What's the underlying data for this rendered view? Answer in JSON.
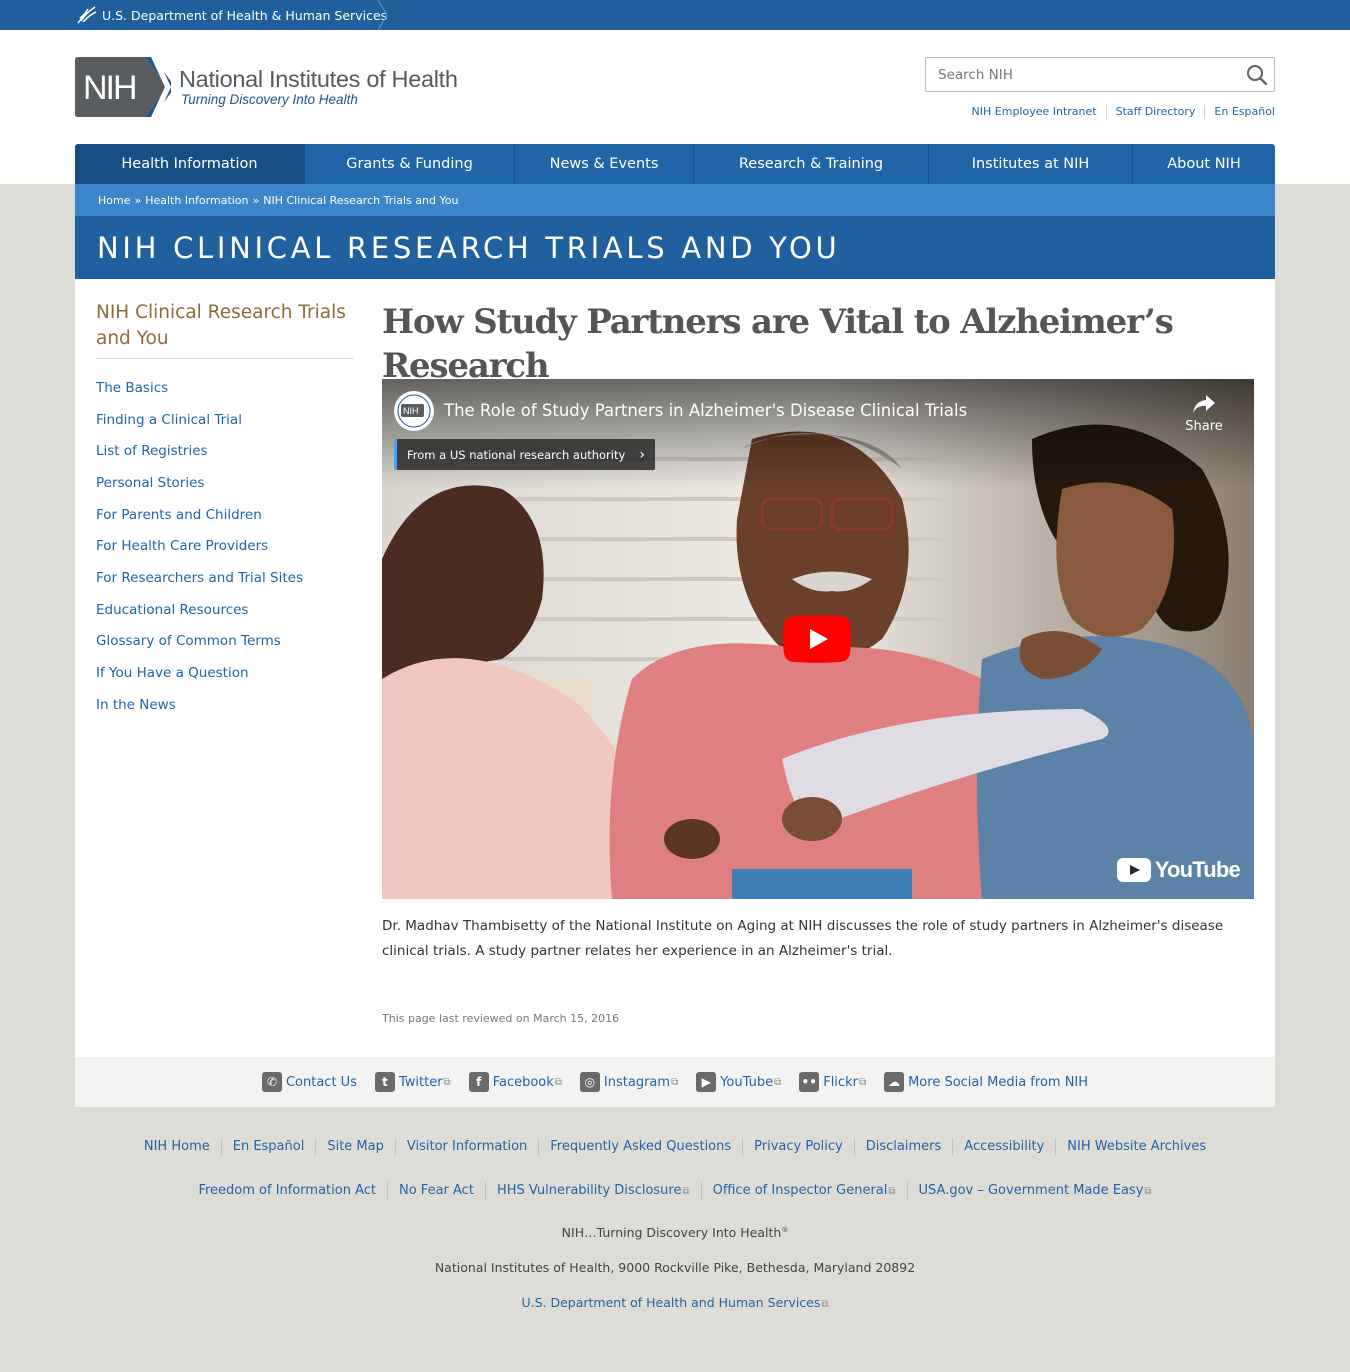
{
  "hhs": {
    "label": "U.S. Department of Health & Human Services"
  },
  "header": {
    "logo_mark": "NIH",
    "logo_title": "National Institutes of Health",
    "logo_tagline": "Turning Discovery Into Health",
    "search_placeholder": "Search NIH",
    "search_icon": "search-icon",
    "util_links": [
      "NIH Employee Intranet",
      "Staff Directory",
      "En Español"
    ]
  },
  "nav": {
    "items": [
      "Health Information",
      "Grants & Funding",
      "News & Events",
      "Research & Training",
      "Institutes at NIH",
      "About NIH"
    ],
    "active": "Health Information"
  },
  "breadcrumb": {
    "items": [
      "Home",
      "Health Information",
      "NIH Clinical Research Trials and You"
    ],
    "separator": "»"
  },
  "banner": {
    "title": "NIH CLINICAL RESEARCH TRIALS AND YOU"
  },
  "sidebar": {
    "title": "NIH Clinical Research Trials and You",
    "items": [
      "The Basics",
      "Finding a Clinical Trial",
      "List of Registries",
      "Personal Stories",
      "For Parents and Children",
      "For Health Care Providers",
      "For Researchers and Trial Sites",
      "Educational Resources",
      "Glossary of Common Terms",
      "If You Have a Question",
      "In the News"
    ]
  },
  "article": {
    "title": "How Study Partners are Vital to Alzheimer’s Research",
    "video": {
      "channel_avatar": "NIH",
      "title": "The Role of Study Partners in Alzheimer's Disease Clinical Trials",
      "share_label": "Share",
      "badge": "From a US national research authority",
      "brand": "YouTube",
      "play_icon": "play-icon"
    },
    "description": "Dr. Madhav Thambisetty of the National Institute on Aging at NIH discusses the role of study partners in Alzheimer's disease clinical trials. A study partner relates her experience in an Alzheimer's trial.",
    "reviewed": "This page last reviewed on March 15, 2016"
  },
  "social": [
    {
      "label": "Contact Us",
      "icon": "phone-icon",
      "external": false
    },
    {
      "label": "Twitter",
      "icon": "twitter-icon",
      "external": true
    },
    {
      "label": "Facebook",
      "icon": "facebook-icon",
      "external": true
    },
    {
      "label": "Instagram",
      "icon": "instagram-icon",
      "external": true
    },
    {
      "label": "YouTube",
      "icon": "youtube-icon",
      "external": true
    },
    {
      "label": "Flickr",
      "icon": "flickr-icon",
      "external": true
    },
    {
      "label": "More Social Media from NIH",
      "icon": "chat-icon",
      "external": false
    }
  ],
  "footer": {
    "row1": [
      "NIH Home",
      "En Español",
      "Site Map",
      "Visitor Information",
      "Frequently Asked Questions",
      "Privacy Policy",
      "Disclaimers",
      "Accessibility",
      "NIH Website Archives"
    ],
    "row2": [
      "Freedom of Information Act",
      "No Fear Act",
      "HHS Vulnerability Disclosure",
      "Office of Inspector General",
      "USA.gov – Government Made Easy"
    ],
    "tagline": "NIH…Turning Discovery Into Health",
    "tagline_mark": "®",
    "address": "National Institutes of Health, 9000 Rockville Pike, Bethesda, Maryland 20892",
    "hhs_link": "U.S. Department of Health and Human Services"
  },
  "colors": {
    "hhs_bar": "#1f5f9c",
    "nav": "#2065a8",
    "nav_active": "#174f85",
    "breadcrumb": "#3a86c8",
    "banner": "#20609f",
    "link": "#1f64a8",
    "sidebar_title": "#8d6d36",
    "page_bg": "#dedcd6",
    "play_red": "#ff0000"
  }
}
